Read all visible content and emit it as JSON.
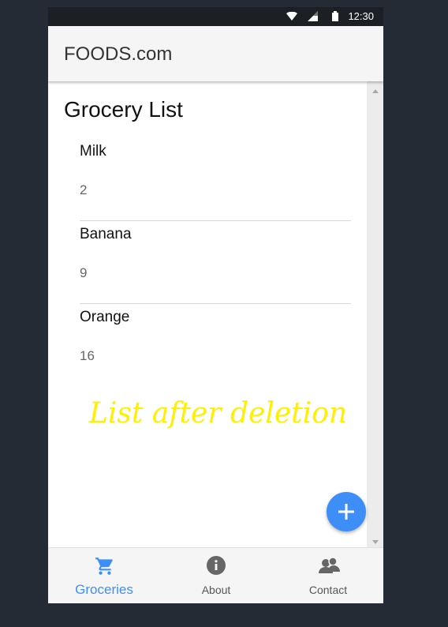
{
  "status_bar": {
    "time": "12:30",
    "icons": [
      "wifi-icon",
      "signal-icon",
      "battery-icon"
    ]
  },
  "app_bar": {
    "title": "FOODS.com"
  },
  "main": {
    "title": "Grocery List",
    "items": [
      {
        "name": "Milk",
        "quantity": "2"
      },
      {
        "name": "Banana",
        "quantity": "9"
      },
      {
        "name": "Orange",
        "quantity": "16"
      }
    ],
    "caption": "List after deletion"
  },
  "fab": {
    "icon": "plus-icon",
    "color": "#3d8ff7"
  },
  "bottom_nav": {
    "items": [
      {
        "label": "Groceries",
        "icon": "cart-icon",
        "active": true
      },
      {
        "label": "About",
        "icon": "info-icon",
        "active": false
      },
      {
        "label": "Contact",
        "icon": "contacts-icon",
        "active": false
      }
    ]
  },
  "colors": {
    "accent": "#3d8ff7",
    "caption": "#ffef00",
    "backdrop": "#252b35"
  }
}
